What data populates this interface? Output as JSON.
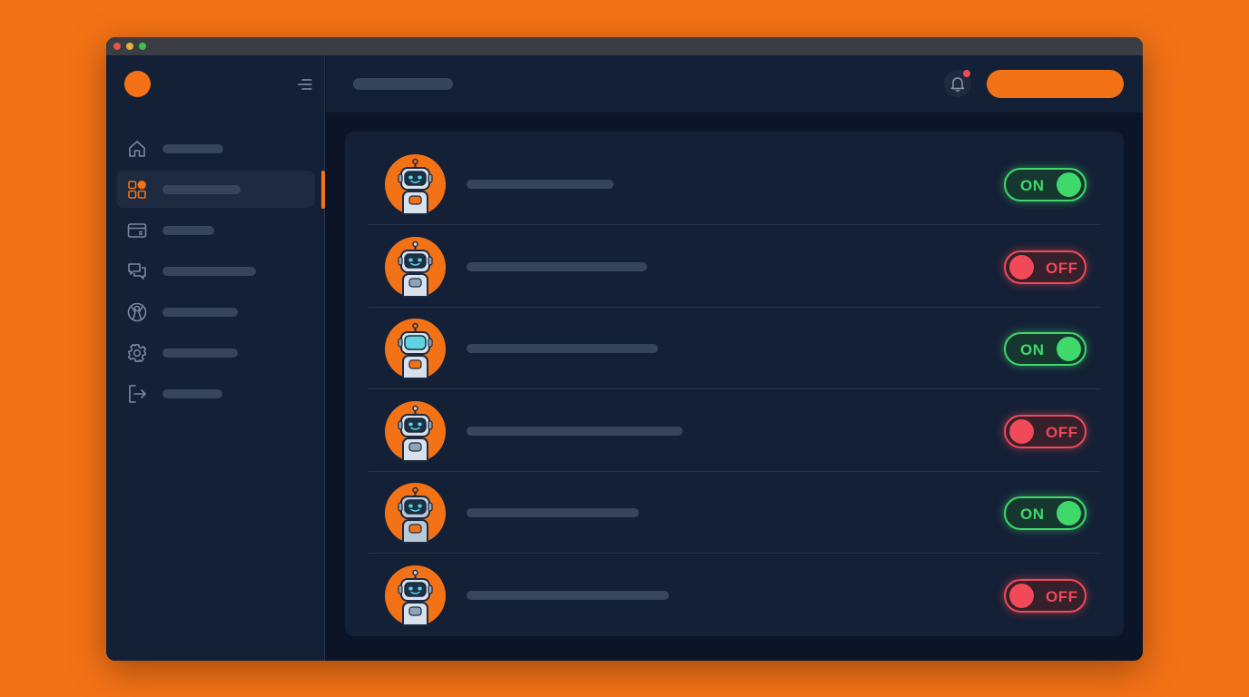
{
  "colors": {
    "background": "#f47216",
    "accent": "#f47216",
    "on": "#3fd86a",
    "off": "#f04a58",
    "traffic_red": "#e8534a",
    "traffic_yellow": "#e0b23a",
    "traffic_green": "#3fc04a"
  },
  "sidebar": {
    "items": [
      {
        "icon": "home-icon",
        "active": false
      },
      {
        "icon": "dashboard-icon",
        "active": true
      },
      {
        "icon": "wallet-icon",
        "active": false
      },
      {
        "icon": "chat-icon",
        "active": false
      },
      {
        "icon": "globe-icon",
        "active": false
      },
      {
        "icon": "gear-icon",
        "active": false
      },
      {
        "icon": "logout-icon",
        "active": false
      }
    ]
  },
  "header": {
    "notification_icon": "bell-icon",
    "has_notification": true
  },
  "bots": [
    {
      "status": "ON",
      "state": "on"
    },
    {
      "status": "OFF",
      "state": "off"
    },
    {
      "status": "ON",
      "state": "on"
    },
    {
      "status": "OFF",
      "state": "off"
    },
    {
      "status": "ON",
      "state": "on"
    },
    {
      "status": "OFF",
      "state": "off"
    }
  ]
}
